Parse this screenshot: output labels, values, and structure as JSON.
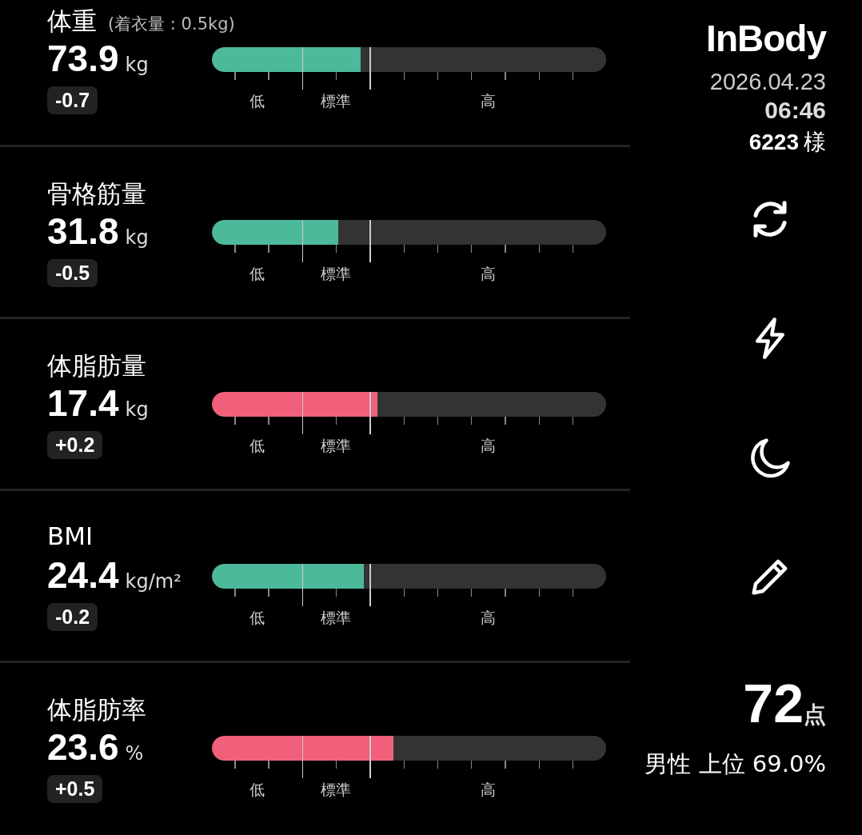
{
  "metrics": [
    {
      "name": "体重",
      "note": "(着衣量 : 0.5kg)",
      "value": "73.9",
      "unit": "kg",
      "delta": "-0.7",
      "level": 0.377,
      "color": "#4cb99a",
      "scale": [
        "低",
        "標準",
        "高"
      ]
    },
    {
      "name": "骨格筋量",
      "value": "31.8",
      "unit": "kg",
      "delta": "-0.5",
      "level": 0.32,
      "color": "#4cb99a",
      "scale": [
        "低",
        "標準",
        "高"
      ]
    },
    {
      "name": "体脂肪量",
      "value": "17.4",
      "unit": "kg",
      "delta": "+0.2",
      "level": 0.42,
      "color": "#f0607a",
      "scale": [
        "低",
        "標準",
        "高"
      ]
    },
    {
      "name": "BMI",
      "value": "24.4",
      "unit": "kg/m²",
      "delta": "-0.2",
      "level": 0.385,
      "color": "#4cb99a",
      "scale": [
        "低",
        "標準",
        "高"
      ]
    },
    {
      "name": "体脂肪率",
      "value": "23.6",
      "unit": "%",
      "delta": "+0.5",
      "level": 0.46,
      "color": "#f0607a",
      "scale": [
        "低",
        "標準",
        "高"
      ]
    }
  ],
  "header": {
    "logo": "InBody",
    "date": "2026.04.23",
    "time": "06:46",
    "user_id": "6223",
    "honorific": "様"
  },
  "actions": [
    {
      "kind": "refresh"
    },
    {
      "kind": "bolt"
    },
    {
      "kind": "moon"
    },
    {
      "kind": "pencil"
    }
  ],
  "score": {
    "value": "72",
    "unit": "点",
    "rank": "男性 上位 69.0%"
  }
}
